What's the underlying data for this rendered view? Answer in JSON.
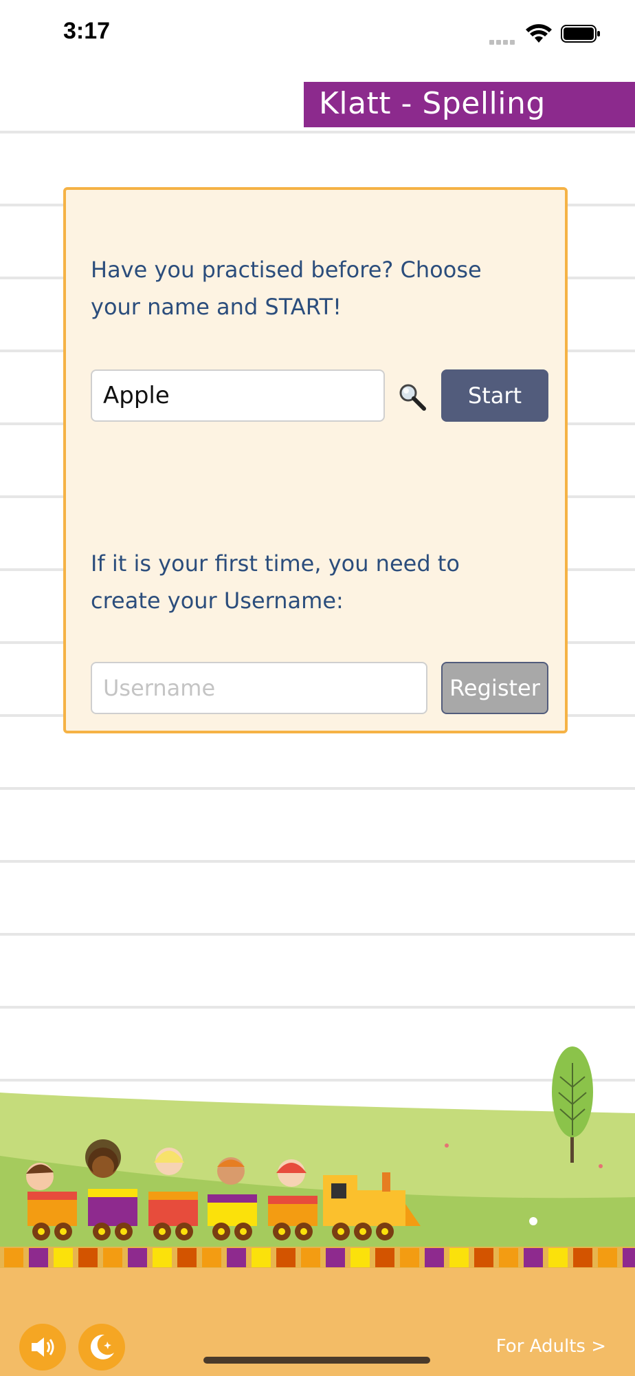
{
  "status_bar": {
    "time": "3:17"
  },
  "header": {
    "title": "Klatt - Spelling"
  },
  "login": {
    "returning_prompt": "Have you practised before? Choose your name and START!",
    "name_value": "Apple",
    "start_label": "Start",
    "new_prompt": "If it is your first time, you need to create your Username:",
    "username_placeholder": "Username",
    "register_label": "Register"
  },
  "footer": {
    "for_adults_label": "For Adults >"
  },
  "colors": {
    "banner": "#8c2a8d",
    "card_border": "#f5b245",
    "card_bg": "#fdf3e2",
    "prompt_text": "#2b4d7c",
    "start_button": "#525c7c",
    "register_button": "#a8a8a8",
    "footer_buttons": "#f5a623"
  },
  "icons": [
    "signal-icon",
    "wifi-icon",
    "battery-icon",
    "search-icon",
    "speaker-icon",
    "moon-icon"
  ]
}
